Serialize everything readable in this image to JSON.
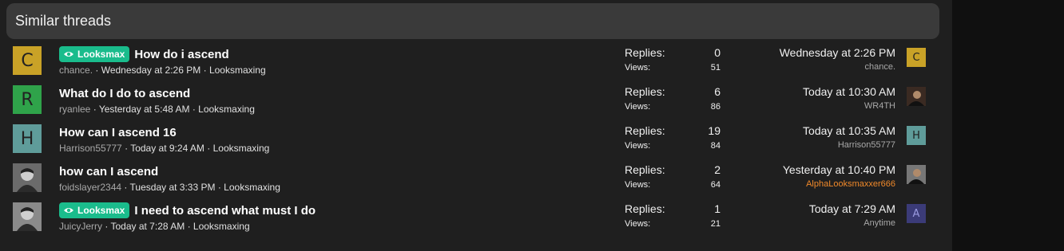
{
  "section": {
    "title": "Similar threads"
  },
  "labels": {
    "replies": "Replies:",
    "views": "Views:"
  },
  "threads": [
    {
      "avatar_letter": "C",
      "avatar_color": "#c9a227",
      "tag": "Looksmax",
      "title": "How do i ascend",
      "author": "chance.",
      "started": "Wednesday at 2:26 PM",
      "forum": "Looksmaxing",
      "replies": "0",
      "views": "51",
      "last_time": "Wednesday at 2:26 PM",
      "last_user": "chance.",
      "last_avatar_letter": "C",
      "last_avatar_color": "#c9a227"
    },
    {
      "avatar_letter": "R",
      "avatar_color": "#2fa34a",
      "tag": "",
      "title": "What do I do to ascend",
      "author": "ryanlee",
      "started": "Yesterday at 5:48 AM",
      "forum": "Looksmaxing",
      "replies": "6",
      "views": "86",
      "last_time": "Today at 10:30 AM",
      "last_user": "WR4TH",
      "last_avatar_letter": "",
      "last_avatar_color": "#3a2a22"
    },
    {
      "avatar_letter": "H",
      "avatar_color": "#5f9c9a",
      "tag": "",
      "title": "How can I ascend 16",
      "author": "Harrison55777",
      "started": "Today at 9:24 AM",
      "forum": "Looksmaxing",
      "replies": "19",
      "views": "84",
      "last_time": "Today at 10:35 AM",
      "last_user": "Harrison55777",
      "last_avatar_letter": "H",
      "last_avatar_color": "#5f9c9a"
    },
    {
      "avatar_letter": "",
      "avatar_color": "#6b6b6b",
      "tag": "",
      "title": "how can I ascend",
      "author": "foidslayer2344",
      "started": "Tuesday at 3:33 PM",
      "forum": "Looksmaxing",
      "replies": "2",
      "views": "64",
      "last_time": "Yesterday at 10:40 PM",
      "last_user": "AlphaLooksmaxxer666",
      "last_avatar_letter": "",
      "last_avatar_color": "#777777"
    },
    {
      "avatar_letter": "",
      "avatar_color": "#8a8a8a",
      "tag": "Looksmax",
      "title": "I need to ascend what must I do",
      "author": "JuicyJerry",
      "started": "Today at 7:28 AM",
      "forum": "Looksmaxing",
      "replies": "1",
      "views": "21",
      "last_time": "Today at 7:29 AM",
      "last_user": "Anytime",
      "last_avatar_letter": "A",
      "last_avatar_color": "#3b3b78"
    }
  ]
}
